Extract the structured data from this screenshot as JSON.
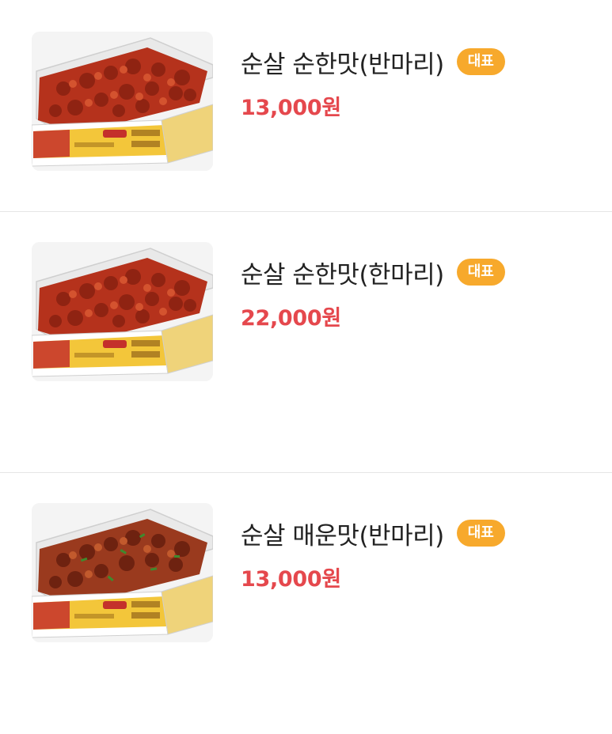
{
  "colors": {
    "price": "#e5484d",
    "badge": "#f7a92c",
    "name": "#222222",
    "divider": "#e6e6e6",
    "box_label": "#f3c63a",
    "chicken": "#b5321c"
  },
  "menu": {
    "items": [
      {
        "name": "순살 순한맛(반마리)",
        "badge": "대표",
        "price": "13,000원",
        "image": "sweet-boneless-chicken-box-photo"
      },
      {
        "name": "순살 순한맛(한마리)",
        "badge": "대표",
        "price": "22,000원",
        "image": "sweet-boneless-chicken-box-photo"
      },
      {
        "name": "순살 매운맛(반마리)",
        "badge": "대표",
        "price": "13,000원",
        "image": "spicy-boneless-chicken-box-photo"
      }
    ]
  }
}
